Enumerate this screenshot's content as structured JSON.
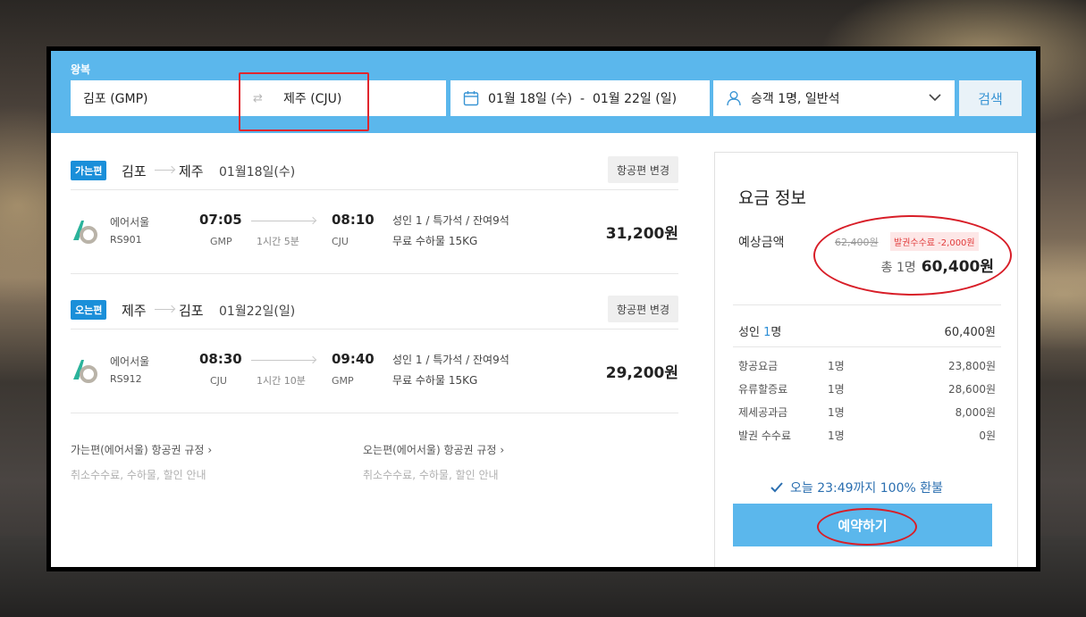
{
  "search": {
    "trip_type": "왕복",
    "origin": "김포 (GMP)",
    "destination": "제주 (CJU)",
    "dates": "01월 18일 (수)  -  01월 22일 (일)",
    "passengers": "승객 1명, 일반석",
    "search_label": "검색"
  },
  "legs": [
    {
      "badge": "가는편",
      "from": "김포",
      "to": "제주",
      "date": "01월18일(수)",
      "change_label": "항공편 변경",
      "airline": "에어서울",
      "flight_no": "RS901",
      "dep_time": "07:05",
      "dep_code": "GMP",
      "duration": "1시간 5분",
      "arr_time": "08:10",
      "arr_code": "CJU",
      "seat_info": "성인 1 / 특가석 / 잔여9석",
      "baggage": "무료 수하물 15KG",
      "price": "31,200원"
    },
    {
      "badge": "오는편",
      "from": "제주",
      "to": "김포",
      "date": "01월22일(일)",
      "change_label": "항공편 변경",
      "airline": "에어서울",
      "flight_no": "RS912",
      "dep_time": "08:30",
      "dep_code": "CJU",
      "duration": "1시간 10분",
      "arr_time": "09:40",
      "arr_code": "GMP",
      "seat_info": "성인 1 / 특가석 / 잔여9석",
      "baggage": "무료 수하물 15KG",
      "price": "29,200원"
    }
  ],
  "rules": [
    {
      "title": "가는편(에어서울) 항공권 규정",
      "sub": "취소수수료, 수하물, 할인 안내"
    },
    {
      "title": "오는편(에어서울) 항공권 규정",
      "sub": "취소수수료, 수하물, 할인 안내"
    }
  ],
  "fare": {
    "title": "요금 정보",
    "estimate_label": "예상금액",
    "original_price": "62,400원",
    "fee_discount": "발권수수료 -2,000원",
    "total_label": "총 1명",
    "total_price": "60,400원",
    "adult_label": "성인",
    "adult_count": "1",
    "adult_unit": "명",
    "adult_amount": "60,400원",
    "breakdown": [
      {
        "label": "항공요금",
        "qty": "1명",
        "amount": "23,800원"
      },
      {
        "label": "유류할증료",
        "qty": "1명",
        "amount": "28,600원"
      },
      {
        "label": "제세공과금",
        "qty": "1명",
        "amount": "8,000원"
      },
      {
        "label": "발권 수수료",
        "qty": "1명",
        "amount": "0원"
      }
    ],
    "refund_note": "오늘 23:49까지 100% 환불",
    "book_label": "예약하기"
  },
  "colors": {
    "header_blue": "#5bb7ec",
    "badge_blue": "#1a8fd9",
    "annotation_red": "#d81e28",
    "airline_green": "#2bb39b"
  }
}
